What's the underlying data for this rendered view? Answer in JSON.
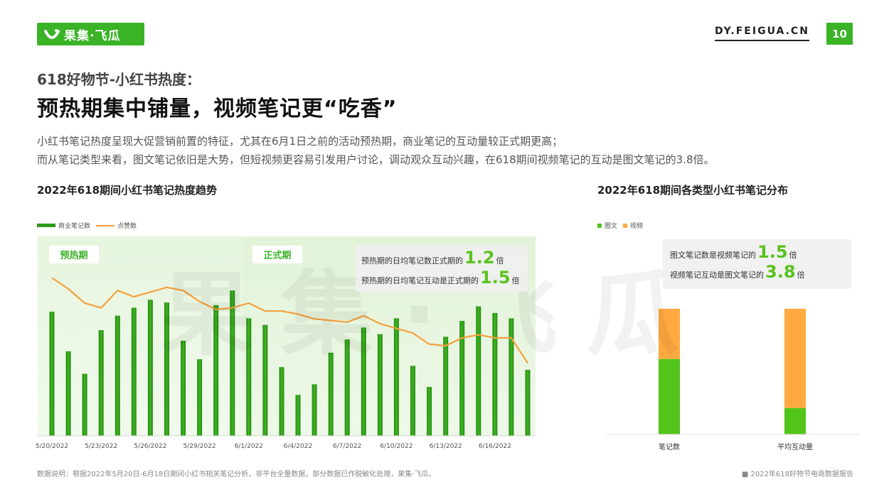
{
  "header": {
    "logo_text": "果集·飞瓜",
    "site_url": "DY.FEIGUA.CN",
    "page_number": "10",
    "brand_color": "#3ab327"
  },
  "subtitle": "618好物节-小红书热度：",
  "title": "预热期集中铺量，视频笔记更“吃香”",
  "description": [
    "小红书笔记热度呈现大促营销前置的特征，尤其在6月1日之前的活动预热期，商业笔记的互动量较正式期更高；",
    "而从笔记类型来看，图文笔记依旧是大势，但短视频更容易引发用户讨论，调动观众互动兴趣，在618期间视频笔记的互动是图文笔记的3.8倍。"
  ],
  "left_chart": {
    "heading": "2022年618期间小红书笔记热度趋势",
    "phase_labels": [
      "预热期",
      "正式期"
    ],
    "callout": {
      "line1_prefix": "预热期的日均笔记数正式期的",
      "line1_value": "1.2",
      "line1_suffix": "倍",
      "line2_prefix": "预热期的日均笔记互动是正式期的",
      "line2_value": "1.5",
      "line2_suffix": "倍"
    }
  },
  "right_chart": {
    "heading": "2022年618期间各类型小红书笔记分布",
    "callout": {
      "line1_prefix": "图文笔记数是视频笔记的",
      "line1_value": "1.5",
      "line1_suffix": "倍",
      "line2_prefix": "视频笔记互动是图文笔记的",
      "line2_value": "3.8",
      "line2_suffix": "倍"
    }
  },
  "watermark": "果集·飞瓜",
  "footnote": "数据说明：根据2022年5月20日-6月18日期间小红书相关笔记分析，非平台全量数据，部分数据已作脱敏化处理，果集·飞瓜。",
  "report_label": "■ 2022年618好物节电商数据报告",
  "chart_data": [
    {
      "type": "bar",
      "x": [
        "5/20/2022",
        "5/21/2022",
        "5/22/2022",
        "5/23/2022",
        "5/24/2022",
        "5/25/2022",
        "5/26/2022",
        "5/27/2022",
        "5/28/2022",
        "5/29/2022",
        "5/30/2022",
        "5/31/2022",
        "6/1/2022",
        "6/2/2022",
        "6/3/2022",
        "6/4/2022",
        "6/5/2022",
        "6/6/2022",
        "6/7/2022",
        "6/8/2022",
        "6/9/2022",
        "6/10/2022",
        "6/11/2022",
        "6/12/2022",
        "6/13/2022",
        "6/14/2022",
        "6/15/2022",
        "6/16/2022",
        "6/17/2022",
        "6/18/2022"
      ],
      "tick_labels": [
        "5/20/2022",
        "5/23/2022",
        "5/26/2022",
        "5/29/2022",
        "6/1/2022",
        "6/4/2022",
        "6/7/2022",
        "6/10/2022",
        "6/13/2022",
        "6/16/2022"
      ],
      "series": [
        {
          "name": "商业笔记数",
          "type": "bar",
          "color": "#2e9a18",
          "values": [
            94,
            64,
            47,
            80,
            91,
            97,
            103,
            101,
            72,
            58,
            99,
            110,
            89,
            84,
            52,
            31,
            39,
            63,
            73,
            82,
            77,
            89,
            53,
            37,
            75,
            87,
            98,
            93,
            89,
            50
          ]
        },
        {
          "name": "点赞数",
          "type": "line",
          "color": "#f5a03c",
          "values": [
            100,
            93,
            84,
            81,
            92,
            88,
            91,
            94,
            92,
            85,
            80,
            81,
            84,
            79,
            79,
            77,
            74,
            73,
            72,
            76,
            71,
            68,
            65,
            58,
            57,
            62,
            64,
            62,
            62,
            46
          ]
        }
      ],
      "phases": [
        {
          "label": "预热期",
          "from": "5/20/2022",
          "to": "5/31/2022"
        },
        {
          "label": "正式期",
          "from": "6/1/2022",
          "to": "6/18/2022"
        }
      ]
    },
    {
      "type": "bar",
      "stacked": true,
      "percent": true,
      "categories": [
        "笔记数",
        "平均互动量"
      ],
      "series": [
        {
          "name": "图文",
          "color": "#52c41a",
          "values": [
            60,
            21
          ]
        },
        {
          "name": "视频",
          "color": "#ffa940",
          "values": [
            40,
            79
          ]
        }
      ]
    }
  ]
}
